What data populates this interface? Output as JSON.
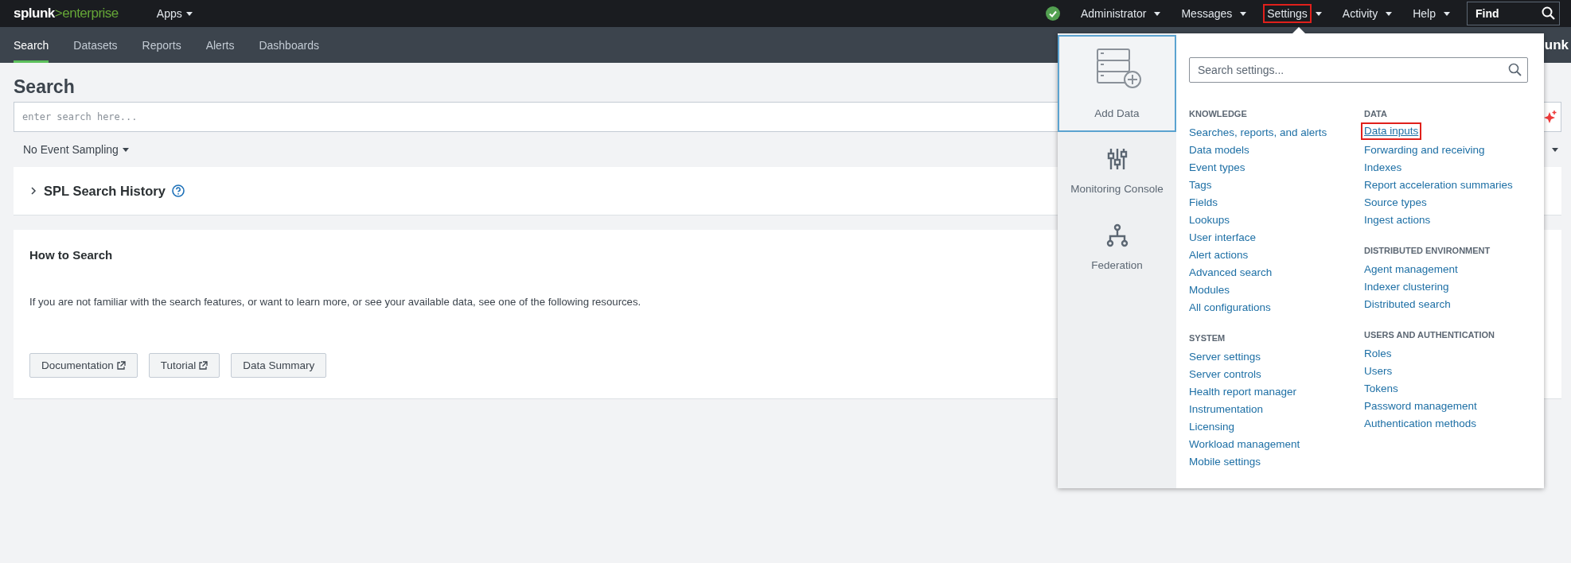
{
  "top_bar": {
    "logo": {
      "brand": "splunk",
      "product": ">enterprise"
    },
    "apps_menu": "Apps",
    "menus": [
      {
        "label": "Administrator",
        "highlighted": false
      },
      {
        "label": "Messages",
        "highlighted": false
      },
      {
        "label": "Settings",
        "highlighted": true
      },
      {
        "label": "Activity",
        "highlighted": false
      },
      {
        "label": "Help",
        "highlighted": false
      }
    ],
    "find_field": {
      "placeholder": "Find"
    }
  },
  "app_bar": {
    "tabs": [
      {
        "label": "Search",
        "selected": true
      },
      {
        "label": "Datasets",
        "selected": false
      },
      {
        "label": "Reports",
        "selected": false
      },
      {
        "label": "Alerts",
        "selected": false
      },
      {
        "label": "Dashboards",
        "selected": false
      }
    ],
    "app_label": "unk"
  },
  "search_page": {
    "title": "Search",
    "search_field": {
      "placeholder": "enter search here..."
    },
    "sampling": "No Event Sampling",
    "history_panel": {
      "title": "SPL Search History",
      "expanded": false
    },
    "how_to": {
      "title": "How to Search",
      "text": "If you are not familiar with the search features, or want to learn more, or see your available data, see one of the following resources.",
      "buttons": [
        {
          "label": "Documentation",
          "kind": "external"
        },
        {
          "label": "Tutorial",
          "kind": "external"
        },
        {
          "label": "Data Summary",
          "kind": "plain"
        }
      ]
    }
  },
  "settings_menu": {
    "search_field": {
      "placeholder": "Search settings..."
    },
    "shortcuts": [
      {
        "label": "Add Data",
        "kind": "add-data",
        "selected": true
      },
      {
        "label": "Monitoring Console",
        "kind": "monitoring",
        "selected": false
      },
      {
        "label": "Federation",
        "kind": "federation",
        "selected": false
      }
    ],
    "columns": [
      [
        {
          "heading": "KNOWLEDGE",
          "links": [
            {
              "label": "Searches, reports, and alerts",
              "highlighted": false
            },
            {
              "label": "Data models",
              "highlighted": false
            },
            {
              "label": "Event types",
              "highlighted": false
            },
            {
              "label": "Tags",
              "highlighted": false
            },
            {
              "label": "Fields",
              "highlighted": false
            },
            {
              "label": "Lookups",
              "highlighted": false
            },
            {
              "label": "User interface",
              "highlighted": false
            },
            {
              "label": "Alert actions",
              "highlighted": false
            },
            {
              "label": "Advanced search",
              "highlighted": false
            },
            {
              "label": "Modules",
              "highlighted": false
            },
            {
              "label": "All configurations",
              "highlighted": false
            }
          ]
        },
        {
          "heading": "SYSTEM",
          "links": [
            {
              "label": "Server settings",
              "highlighted": false
            },
            {
              "label": "Server controls",
              "highlighted": false
            },
            {
              "label": "Health report manager",
              "highlighted": false
            },
            {
              "label": "Instrumentation",
              "highlighted": false
            },
            {
              "label": "Licensing",
              "highlighted": false
            },
            {
              "label": "Workload management",
              "highlighted": false
            },
            {
              "label": "Mobile settings",
              "highlighted": false
            }
          ]
        }
      ],
      [
        {
          "heading": "DATA",
          "links": [
            {
              "label": "Data inputs",
              "highlighted": true
            },
            {
              "label": "Forwarding and receiving",
              "highlighted": false
            },
            {
              "label": "Indexes",
              "highlighted": false
            },
            {
              "label": "Report acceleration summaries",
              "highlighted": false
            },
            {
              "label": "Source types",
              "highlighted": false
            },
            {
              "label": "Ingest actions",
              "highlighted": false
            }
          ]
        },
        {
          "heading": "DISTRIBUTED ENVIRONMENT",
          "links": [
            {
              "label": "Agent management",
              "highlighted": false
            },
            {
              "label": "Indexer clustering",
              "highlighted": false
            },
            {
              "label": "Distributed search",
              "highlighted": false
            }
          ]
        },
        {
          "heading": "USERS AND AUTHENTICATION",
          "links": [
            {
              "label": "Roles",
              "highlighted": false
            },
            {
              "label": "Users",
              "highlighted": false
            },
            {
              "label": "Tokens",
              "highlighted": false
            },
            {
              "label": "Password management",
              "highlighted": false
            },
            {
              "label": "Authentication methods",
              "highlighted": false
            }
          ]
        }
      ]
    ]
  }
}
